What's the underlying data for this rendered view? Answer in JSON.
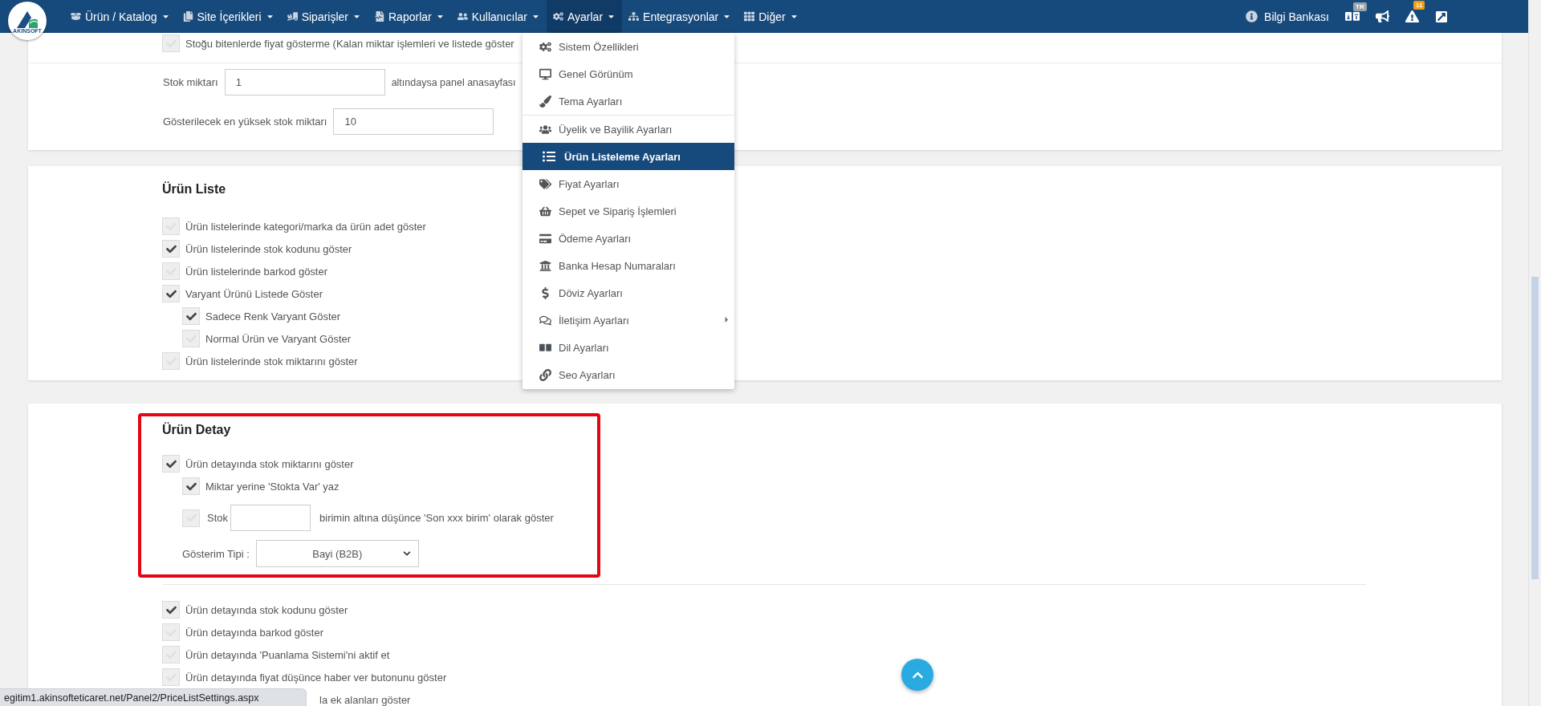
{
  "navbar": {
    "logo_text": "AKINSOFT",
    "menu": [
      {
        "label": "Ürün / Katalog",
        "selected": false
      },
      {
        "label": "Site İçerikleri",
        "selected": false
      },
      {
        "label": "Siparişler",
        "selected": false
      },
      {
        "label": "Raporlar",
        "selected": false
      },
      {
        "label": "Kullanıcılar",
        "selected": false
      },
      {
        "label": "Ayarlar",
        "selected": true
      },
      {
        "label": "Entegrasyonlar",
        "selected": false
      },
      {
        "label": "Diğer",
        "selected": false
      }
    ],
    "help": "Bilgi Bankası",
    "language_badge": "TR",
    "alerts_badge": "11"
  },
  "dropdown": {
    "items": [
      {
        "kind": "item",
        "label": "Sistem Özellikleri",
        "selected": false
      },
      {
        "kind": "item",
        "label": "Genel Görünüm",
        "selected": false
      },
      {
        "kind": "item",
        "label": "Tema Ayarları",
        "selected": false
      },
      {
        "kind": "divider"
      },
      {
        "kind": "item",
        "label": "Üyelik ve Bayilik Ayarları",
        "selected": false
      },
      {
        "kind": "item",
        "label": "Ürün Listeleme Ayarları",
        "selected": true
      },
      {
        "kind": "item",
        "label": "Fiyat Ayarları",
        "selected": false
      },
      {
        "kind": "item",
        "label": "Sepet ve Sipariş İşlemleri",
        "selected": false
      },
      {
        "kind": "item",
        "label": "Ödeme Ayarları",
        "selected": false
      },
      {
        "kind": "item",
        "label": "Banka Hesap Numaraları",
        "selected": false
      },
      {
        "kind": "item",
        "label": "Döviz Ayarları",
        "selected": false
      },
      {
        "kind": "item",
        "label": "İletişim Ayarları",
        "selected": false,
        "submenu": true
      },
      {
        "kind": "item",
        "label": "Dil Ayarları",
        "selected": false
      },
      {
        "kind": "item",
        "label": "Seo Ayarları",
        "selected": false
      }
    ]
  },
  "stock_card": {
    "option": {
      "label": "Stoğu bitenlerde fiyat gösterme (Kalan miktar işlemleri ve listede göster",
      "checked": false
    },
    "stock_limit": {
      "label": "Stok miktarı",
      "value": "1",
      "suffix": "altındaysa panel anasayfası"
    },
    "max_stock": {
      "label": "Gösterilecek en yüksek stok miktarı",
      "value": "10"
    }
  },
  "list_card": {
    "title": "Ürün Liste",
    "options": [
      {
        "label": "Ürün listelerinde kategori/marka da ürün adet göster",
        "checked": false
      },
      {
        "label": "Ürün listelerinde stok kodunu göster",
        "checked": true
      },
      {
        "label": "Ürün listelerinde barkod göster",
        "checked": false
      },
      {
        "label": "Varyant Ürünü Listede Göster",
        "checked": true,
        "children": [
          {
            "label": "Sadece Renk Varyant Göster",
            "checked": true
          },
          {
            "label": "Normal Ürün ve Varyant Göster",
            "checked": false
          }
        ]
      },
      {
        "label": "Ürün listelerinde stok miktarını göster",
        "checked": false
      }
    ]
  },
  "detail_card": {
    "title": "Ürün Detay",
    "highlighted": true,
    "stock_option": {
      "label": "Ürün detayında stok miktarını göster",
      "checked": true
    },
    "sub_options": [
      {
        "kind": "checkbox",
        "label": "Miktar yerine 'Stokta Var' yaz",
        "checked": true
      },
      {
        "kind": "threshold",
        "label": "Stok",
        "suffix": "birimin altına düşünce 'Son xxx birim' olarak göster",
        "checked": false
      }
    ],
    "display_type": {
      "label": "Gösterim Tipi :",
      "value": "Bayi (B2B)"
    },
    "options": [
      {
        "label": "Ürün detayında stok kodunu göster",
        "checked": true
      },
      {
        "label": "Ürün detayında barkod göster",
        "checked": false
      },
      {
        "label": "Ürün detayında 'Puanlama Sistemi'ni aktif et",
        "checked": false
      },
      {
        "label": "Ürün detayında fiyat düşünce haber ver butonunu göster",
        "checked": false
      }
    ],
    "covered_text": "la ek alanları göster"
  },
  "status_bar": {
    "url": "egitim1.akinsofteticaret.net/Panel2/PriceListSettings.aspx"
  }
}
